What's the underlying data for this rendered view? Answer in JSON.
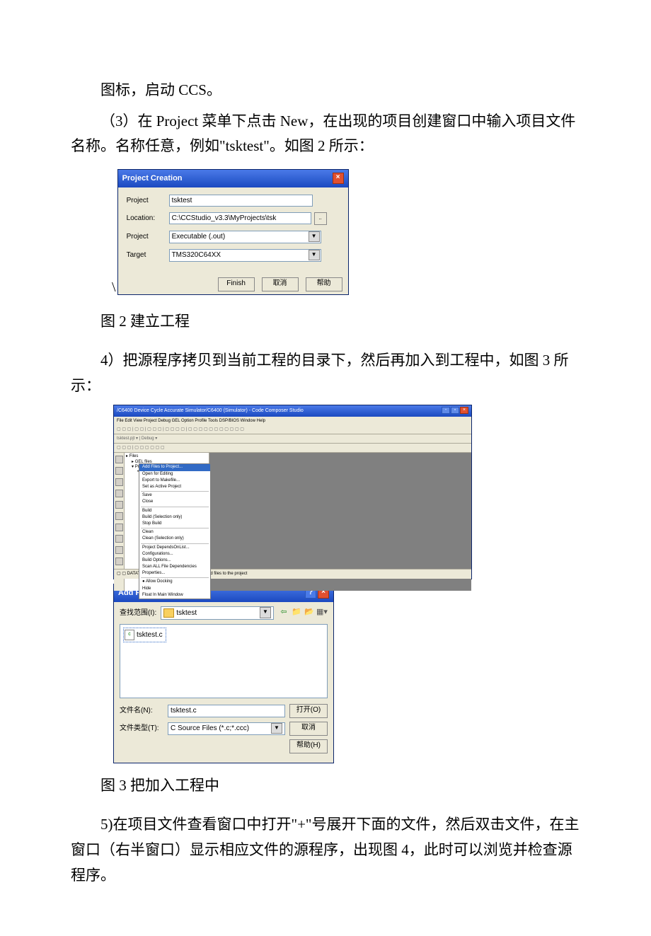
{
  "body": {
    "p1": "图标，启动 CCS。",
    "p2": "（3）在 Project 菜单下点击 New，在出现的项目创建窗口中输入项目文件名称。名称任意，例如\"tsktest\"。如图 2 所示：",
    "cap2": "图 2 建立工程",
    "p3": "4）把源程序拷贝到当前工程的目录下，然后再加入到工程中，如图 3 所示：",
    "cap3": "图 3 把加入工程中",
    "p4": "5)在项目文件查看窗口中打开\"+\"号展开下面的文件，然后双击文件，在主窗口（右半窗口）显示相应文件的源程序，出现图 4，此时可以浏览并检查源程序。",
    "slash": "\\"
  },
  "dlg1": {
    "title": "Project Creation",
    "rows": {
      "project_lbl": "Project",
      "project_val": "tsktest",
      "location_lbl": "Location:",
      "location_val": "C:\\CCStudio_v3.3\\MyProjects\\tsk",
      "type_lbl": "Project",
      "type_val": "Executable (.out)",
      "target_lbl": "Target",
      "target_val": "TMS320C64XX"
    },
    "buttons": {
      "finish": "Finish",
      "cancel": "取消",
      "help": "帮助"
    }
  },
  "ide": {
    "title": "/C6400 Device Cycle Accurate Simulator/C6400 (Simulator) - Code Composer Studio",
    "menu": "File Edit View Project Debug GEL Option Profile Tools DSP/BIOS Window Help",
    "toolbar1": "▢ ▢ ▢ | ▢ ▢ | ▢ ▢ ▢ | ▢ ▢ ▢ ▢ | ▢ ▢ ▢ ▢ ▢ ▢ ▢ ▢ ▢ ▢ ▢",
    "toolbar2": "tsktest.pjt ▾  | Debug ▾",
    "toolbar3": "▢ ▢ ▢ | ▢ ▢ ▢ ▢ ▢ ▢",
    "tree": {
      "root": "Files",
      "gel": "GEL files",
      "proj": "Projects",
      "projsub": "tsktest.pjt"
    },
    "ctx": {
      "i0": "Add Files to Project...",
      "i1": "Open for Editing",
      "i2": "Export to Makefile...",
      "i3": "Set as Active Project",
      "i4": "Save",
      "i5": "Close",
      "i6": "Build",
      "i7": "Build (Selection only)",
      "i8": "Stop Build",
      "i9": "Clean",
      "i10": "Clean (Selection only)",
      "i11": "Project DependsOnList...",
      "i12": "Configurations...",
      "i13": "Build Options...",
      "i14": "Scan ALL File Dependencies",
      "i15": "Properties...",
      "i16": "● Allow Docking",
      "i17": "Hide",
      "i18": "Float In Main Window"
    },
    "status_l": "▢ ▢ DATATYPE",
    "status_r": "Add files to the project"
  },
  "dlg3": {
    "title": "Add Files to Project",
    "lookin_lbl": "查找范围(I):",
    "folder": "tsktest",
    "file": "tsktest.c",
    "filename_lbl": "文件名(N):",
    "filename_val": "tsktest.c",
    "filetype_lbl": "文件类型(T):",
    "filetype_val": "C Source Files (*.c;*.ccc)",
    "open": "打开(O)",
    "cancel": "取消",
    "help": "帮助(H)"
  }
}
